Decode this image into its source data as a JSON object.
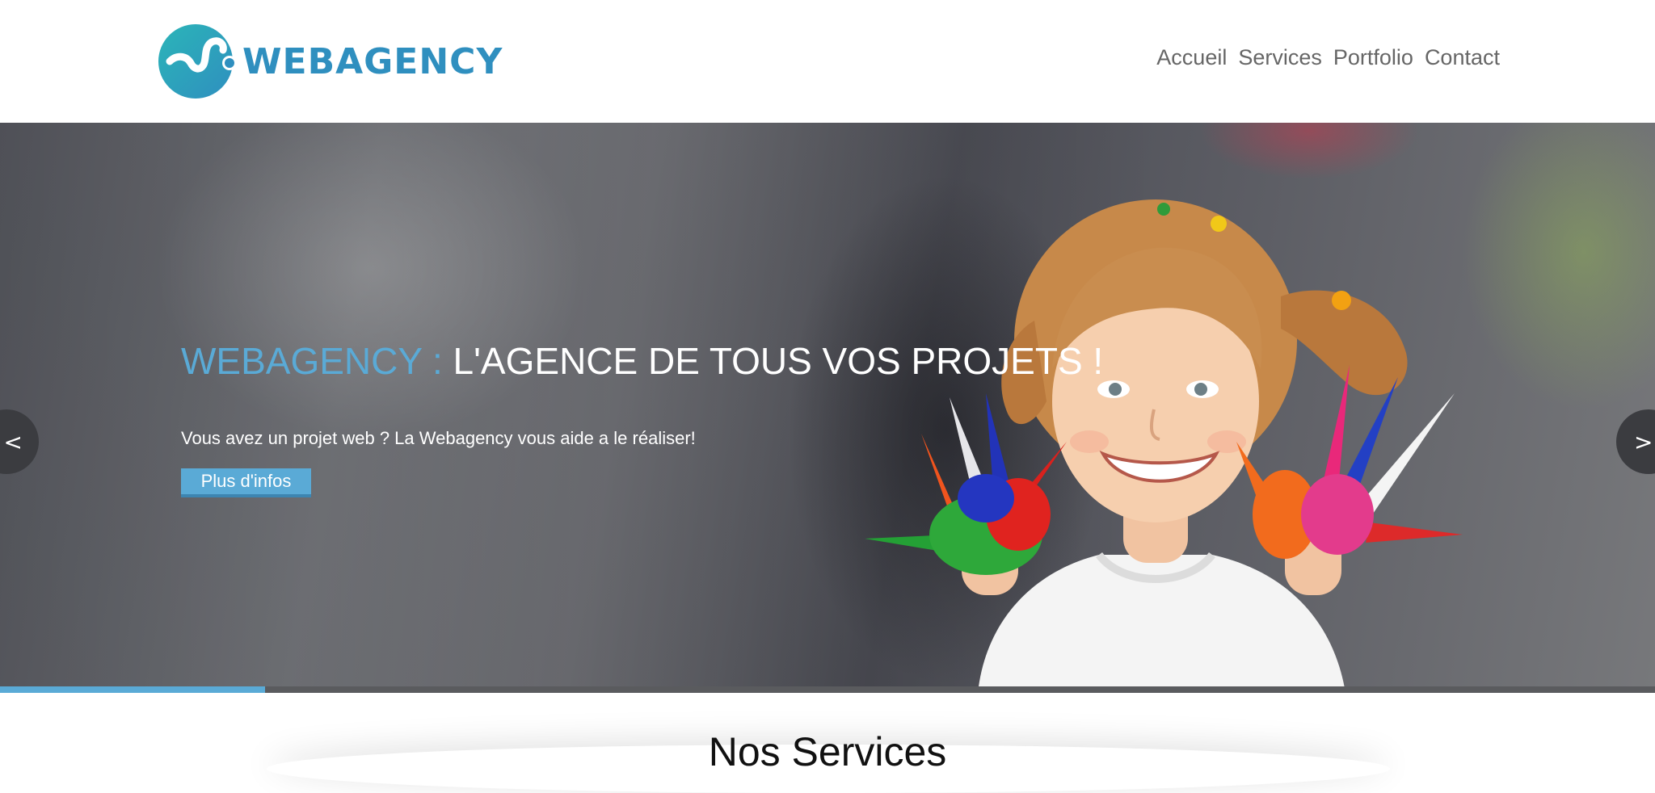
{
  "header": {
    "logo_text": "WEBAGENCY",
    "nav": [
      {
        "label": "Accueil"
      },
      {
        "label": "Services"
      },
      {
        "label": "Portfolio"
      },
      {
        "label": "Contact"
      }
    ]
  },
  "hero": {
    "title_accent": "WEBAGENCY :",
    "title_main": " L'AGENCE DE TOUS VOS PROJETS !",
    "subtitle": "Vous avez un projet web ? La Webagency vous aide a le réaliser!",
    "button_label": "Plus d'infos",
    "prev_label": "<",
    "next_label": ">",
    "progress_fraction": 0.16
  },
  "services": {
    "title": "Nos Services"
  },
  "colors": {
    "accent": "#5aaad6",
    "logo": "#2f8fbf",
    "nav_text": "#666666"
  },
  "icons": {
    "logo": "webagency-logo-icon",
    "prev": "chevron-left-icon",
    "next": "chevron-right-icon"
  }
}
